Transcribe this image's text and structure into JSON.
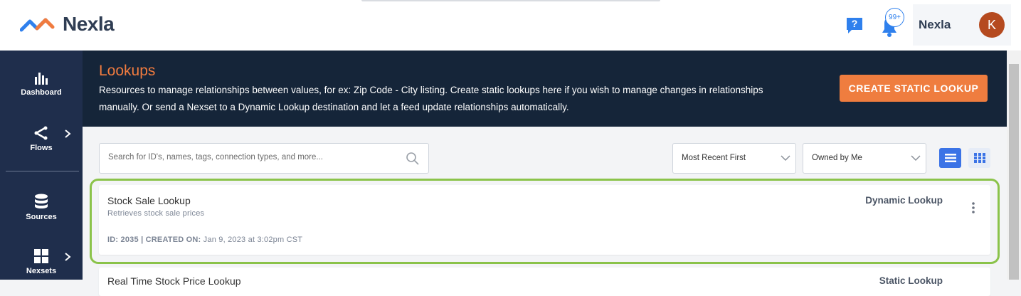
{
  "header": {
    "brand_name": "Nexla",
    "notification_badge": "99+",
    "user_name": "Nexla",
    "avatar_initial": "K",
    "brand_colors": {
      "logo_orange": "#f07b3f",
      "logo_blue": "#2f80ed"
    }
  },
  "sidebar": {
    "items": [
      {
        "label": "Dashboard",
        "icon": "bar-chart-icon",
        "has_submenu": false
      },
      {
        "label": "Flows",
        "icon": "flow-icon",
        "has_submenu": true
      },
      {
        "label": "Sources",
        "icon": "database-icon",
        "has_submenu": false
      },
      {
        "label": "Nexsets",
        "icon": "grid-icon",
        "has_submenu": true
      }
    ]
  },
  "banner": {
    "title": "Lookups",
    "description": "Resources to manage relationships between values, for ex: Zip Code - City listing. Create static lookups here if you wish to manage changes in relationships manually. Or send a Nexset to a Dynamic Lookup destination and let a feed update relationships automatically.",
    "create_button_label": "CREATE STATIC LOOKUP"
  },
  "filters": {
    "search_placeholder": "Search for ID's, names, tags, connection types, and more...",
    "search_value": "",
    "sort_selected": "Most Recent First",
    "owner_selected": "Owned by Me",
    "active_view": "list"
  },
  "lookups": [
    {
      "title": "Stock Sale Lookup",
      "description": "Retrieves stock sale prices",
      "id_label": "ID:",
      "id_value": "2035",
      "separator": "|",
      "created_label": "CREATED ON:",
      "created_value": "Jan 9, 2023 at 3:02pm CST",
      "type": "Dynamic Lookup",
      "highlighted": true
    },
    {
      "title": "Real Time Stock Price Lookup",
      "type": "Static Lookup",
      "highlighted": false
    }
  ]
}
